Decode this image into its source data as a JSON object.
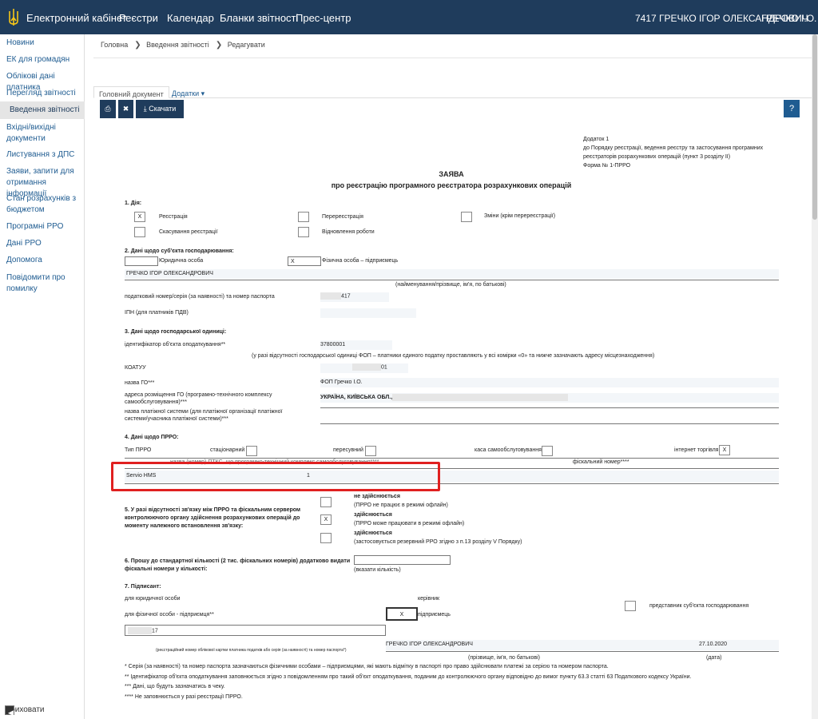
{
  "header": {
    "brand": "Електронний кабінет",
    "nav": [
      "Реєстри",
      "Календар",
      "Бланки звітності",
      "Прес-центр"
    ],
    "user_full": "7417 ГРЕЧКО ІГОР ОЛЕКСАНДРОВИЧ",
    "user_short": "ГРЕЧКО І.О."
  },
  "sidebar": {
    "items": [
      "Новини",
      "ЕК для громадян",
      "Облікові дані платника",
      "Перегляд звітності",
      "Введення звітності",
      "Вхідні/вихідні документи",
      "Листування з ДПС",
      "Заяви, запити для отримання інформації",
      "Стан розрахунків з бюджетом",
      "Програмні РРО",
      "Дані РРО",
      "Допомога",
      "Повідомити про помилку"
    ],
    "collapse": "Приховати"
  },
  "breadcrumb": [
    "Головна",
    "Введення звітності",
    "Редагувати"
  ],
  "tabs": {
    "main": "Головний документ",
    "extra": "Додатки ▾"
  },
  "toolbar": {
    "download": "Скачати",
    "help": "?"
  },
  "doc": {
    "annex": [
      "Додаток 1",
      "до Порядку реєстрації, ведення реєстру та застосування програмних",
      "реєстраторів розрахункових операцій (пункт 3 розділу II)",
      "Форма № 1-ПРРО"
    ],
    "title": "ЗАЯВА",
    "subtitle": "про реєстрацію програмного реєстратора розрахункових операцій",
    "s1": "1. Дія:",
    "a1": "Реєстрація",
    "a2": "Перереєстрація",
    "a3": "Зміни (крім перереєстрації)",
    "a4": "Скасування реєстрації",
    "a5": "Відновлення роботи",
    "s2": "2. Дані щодо суб'єкта господарювання:",
    "legal": "Юридична особа",
    "phys": "Фізична особа – підприємець",
    "x": "X",
    "name": "ГРЕЧКО ІГОР ОЛЕКСАНДРОВИЧ",
    "name_hint": "(найменування/прізвище, ім'я, по батькові)",
    "tax_label": "податковий номер/серія (за наявності) та номер паспорта",
    "tax_val": "417",
    "ipn": "ІПН (для платників ПДВ)",
    "s3": "3. Дані щодо господарської одиниці:",
    "obj_label": "ідентифікатор об'єкта оподаткування**",
    "obj_val": "37800001",
    "obj_hint": "(у разі відсутності господарської одиниці ФОП – платники єдиного податку проставляють у всі комірки «0» та нижче зазначають адресу місцезнаходження)",
    "koatuu": "КОАТУУ",
    "koatuu_val": "01",
    "go_name": "назва ГО***",
    "go_val": "ФОП Гречко І.О.",
    "addr_label": "адреса розміщення ГО (програмно-технічного комплексу самообслуговування)***",
    "addr_val": "УКРАЇНА, КИЇВСЬКА ОБЛ.,",
    "pay_label": "назва платіжної системи (для платіжної організації платіжної системи/учасника платіжної системи)***",
    "s4": "4. Дані щодо ПРРО:",
    "type": "Тип ПРРО",
    "t1": "стаціонарний",
    "t2": "пересувний",
    "t3": "каса самообслуговування",
    "t4": "інтернет торгівля",
    "col1": "назва (номер) ПТКС, що програмно-технічний комплекс самообслуговування****",
    "col2": "фіскальний номер****",
    "prro": "Servio HMS",
    "prro_num": "1",
    "s5": "5. У разі відсутності зв'язку між ПРРО та фіскальним сервером контролюючого органу здійснення розрахункових операцій до моменту належного встановлення зв'язку:",
    "o1": "не здійснюється",
    "o1h": "(ПРРО не працює в режимі офлайн)",
    "o2": "здійснюється",
    "o2h": "(ПРРО може працювати в режимі офлайн)",
    "o3": "здійснюється",
    "o3h": "(застосовується резервний РРО згідно з п.13 розділу V Порядку)",
    "s6": "6. Прошу до стандартної кількості (2 тис. фіскальних номерів) додатково видати фіскальні номери у кількості:",
    "s6h": "(вказати кількість)",
    "s7": "7. Підписант:",
    "legal_p": "для юридичної особи",
    "head": "керівник",
    "rep": "представник суб'єкта господарювання",
    "phys_p": "для фізичної особи - підприємця**",
    "ent": "підприємець",
    "sign_val": "17",
    "sign_hint": "(реєстраційний номер облікової картки платника податків або серія (за наявності) та номер паспорта*)",
    "signer": "ГРЕЧКО ІГОР ОЛЕКСАНДРОВИЧ",
    "date": "27.10.2020",
    "signer_hint": "(прізвище, ім'я, по батькові)",
    "date_hint": "(дата)",
    "n1": "* Серія (за наявності) та номер паспорта зазначаються фізичними особами – підприємцями, які мають відмітку в паспорті про право здійснювати платежі за серією та номером паспорта.",
    "n2": "** Ідентифікатор об'єкта оподаткування заповнюється згідно з повідомленням про такий об'єкт оподаткування, поданим до контролюючого органу відповідно до вимог пункту 63.3 статті 63 Податкового кодексу України.",
    "n3": "*** Дані, що будуть зазначатись в чеку.",
    "n4": "**** Не заповнюється у разі реєстрації ПРРО."
  }
}
